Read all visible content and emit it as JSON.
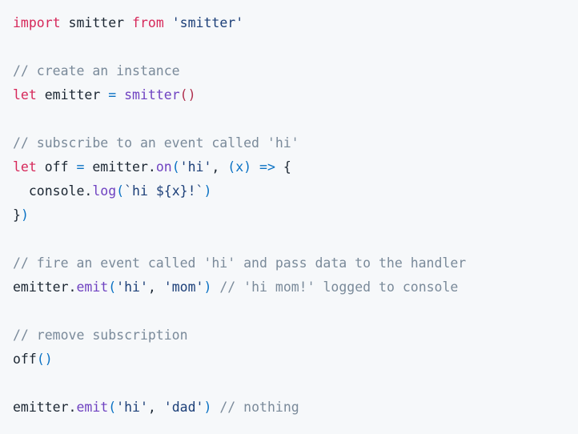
{
  "editor": {
    "background_color": "#f6f8fa",
    "font_size_px": 16.5,
    "line_height_px": 30,
    "language": "javascript"
  },
  "colors": {
    "keyword": "#d6285a",
    "plain": "#1c2733",
    "string": "#1c3f78",
    "comment": "#7a8a9a",
    "function": "#6f42c1",
    "operator": "#0b72c4",
    "punctuation": "#0b72c4",
    "paren_red": "#b0304e"
  },
  "code": {
    "full_text": "import smitter from 'smitter'\n\n// create an instance\nlet emitter = smitter()\n\n// subscribe to an event called 'hi'\nlet off = emitter.on('hi', (x) => {\n  console.log(`hi ${x}!`)\n})\n\n// fire an event called 'hi' and pass data to the handler\nemitter.emit('hi', 'mom') // 'hi mom!' logged to console\n\n// remove subscription\noff()\n\nemitter.emit('hi', 'dad') // nothing",
    "lines": [
      {
        "index": 1,
        "text": "import smitter from 'smitter'",
        "tokens": [
          {
            "t": "import",
            "c": "keyword"
          },
          {
            "t": " ",
            "c": "plain"
          },
          {
            "t": "smitter",
            "c": "plain"
          },
          {
            "t": " ",
            "c": "plain"
          },
          {
            "t": "from",
            "c": "keyword"
          },
          {
            "t": " ",
            "c": "plain"
          },
          {
            "t": "'smitter'",
            "c": "string"
          }
        ]
      },
      {
        "index": 2,
        "text": "",
        "tokens": []
      },
      {
        "index": 3,
        "text": "// create an instance",
        "tokens": [
          {
            "t": "// create an instance",
            "c": "comment"
          }
        ]
      },
      {
        "index": 4,
        "text": "let emitter = smitter()",
        "tokens": [
          {
            "t": "let",
            "c": "keyword"
          },
          {
            "t": " ",
            "c": "plain"
          },
          {
            "t": "emitter",
            "c": "plain"
          },
          {
            "t": " ",
            "c": "plain"
          },
          {
            "t": "=",
            "c": "operator"
          },
          {
            "t": " ",
            "c": "plain"
          },
          {
            "t": "smitter",
            "c": "function"
          },
          {
            "t": "()",
            "c": "paren_red"
          }
        ]
      },
      {
        "index": 5,
        "text": "",
        "tokens": []
      },
      {
        "index": 6,
        "text": "// subscribe to an event called 'hi'",
        "tokens": [
          {
            "t": "// subscribe to an event called 'hi'",
            "c": "comment"
          }
        ]
      },
      {
        "index": 7,
        "text": "let off = emitter.on('hi', (x) => {",
        "tokens": [
          {
            "t": "let",
            "c": "keyword"
          },
          {
            "t": " ",
            "c": "plain"
          },
          {
            "t": "off",
            "c": "plain"
          },
          {
            "t": " ",
            "c": "plain"
          },
          {
            "t": "=",
            "c": "operator"
          },
          {
            "t": " ",
            "c": "plain"
          },
          {
            "t": "emitter",
            "c": "plain"
          },
          {
            "t": ".",
            "c": "plain"
          },
          {
            "t": "on",
            "c": "function"
          },
          {
            "t": "(",
            "c": "punctuation"
          },
          {
            "t": "'hi'",
            "c": "string"
          },
          {
            "t": ",",
            "c": "plain"
          },
          {
            "t": " ",
            "c": "plain"
          },
          {
            "t": "(x)",
            "c": "punctuation"
          },
          {
            "t": " ",
            "c": "plain"
          },
          {
            "t": "=>",
            "c": "operator"
          },
          {
            "t": " ",
            "c": "plain"
          },
          {
            "t": "{",
            "c": "plain"
          }
        ]
      },
      {
        "index": 8,
        "text": "  console.log(`hi ${x}!`)",
        "tokens": [
          {
            "t": "  ",
            "c": "plain"
          },
          {
            "t": "console",
            "c": "plain"
          },
          {
            "t": ".",
            "c": "plain"
          },
          {
            "t": "log",
            "c": "function"
          },
          {
            "t": "(",
            "c": "punctuation"
          },
          {
            "t": "`hi ${x}!`",
            "c": "string"
          },
          {
            "t": ")",
            "c": "punctuation"
          }
        ]
      },
      {
        "index": 9,
        "text": "})",
        "tokens": [
          {
            "t": "}",
            "c": "plain"
          },
          {
            "t": ")",
            "c": "punctuation"
          }
        ]
      },
      {
        "index": 10,
        "text": "",
        "tokens": []
      },
      {
        "index": 11,
        "text": "// fire an event called 'hi' and pass data to the handler",
        "tokens": [
          {
            "t": "// fire an event called 'hi' and pass data to the handler",
            "c": "comment"
          }
        ]
      },
      {
        "index": 12,
        "text": "emitter.emit('hi', 'mom') // 'hi mom!' logged to console",
        "tokens": [
          {
            "t": "emitter",
            "c": "plain"
          },
          {
            "t": ".",
            "c": "plain"
          },
          {
            "t": "emit",
            "c": "function"
          },
          {
            "t": "(",
            "c": "punctuation"
          },
          {
            "t": "'hi'",
            "c": "string"
          },
          {
            "t": ",",
            "c": "plain"
          },
          {
            "t": " ",
            "c": "plain"
          },
          {
            "t": "'mom'",
            "c": "string"
          },
          {
            "t": ")",
            "c": "punctuation"
          },
          {
            "t": " ",
            "c": "plain"
          },
          {
            "t": "// 'hi mom!' logged to console",
            "c": "comment"
          }
        ]
      },
      {
        "index": 13,
        "text": "",
        "tokens": []
      },
      {
        "index": 14,
        "text": "// remove subscription",
        "tokens": [
          {
            "t": "// remove subscription",
            "c": "comment"
          }
        ]
      },
      {
        "index": 15,
        "text": "off()",
        "tokens": [
          {
            "t": "off",
            "c": "plain"
          },
          {
            "t": "()",
            "c": "punctuation"
          }
        ]
      },
      {
        "index": 16,
        "text": "",
        "tokens": []
      },
      {
        "index": 17,
        "text": "emitter.emit('hi', 'dad') // nothing",
        "tokens": [
          {
            "t": "emitter",
            "c": "plain"
          },
          {
            "t": ".",
            "c": "plain"
          },
          {
            "t": "emit",
            "c": "function"
          },
          {
            "t": "(",
            "c": "punctuation"
          },
          {
            "t": "'hi'",
            "c": "string"
          },
          {
            "t": ",",
            "c": "plain"
          },
          {
            "t": " ",
            "c": "plain"
          },
          {
            "t": "'dad'",
            "c": "string"
          },
          {
            "t": ")",
            "c": "punctuation"
          },
          {
            "t": " ",
            "c": "plain"
          },
          {
            "t": "// nothing",
            "c": "comment"
          }
        ]
      }
    ]
  }
}
